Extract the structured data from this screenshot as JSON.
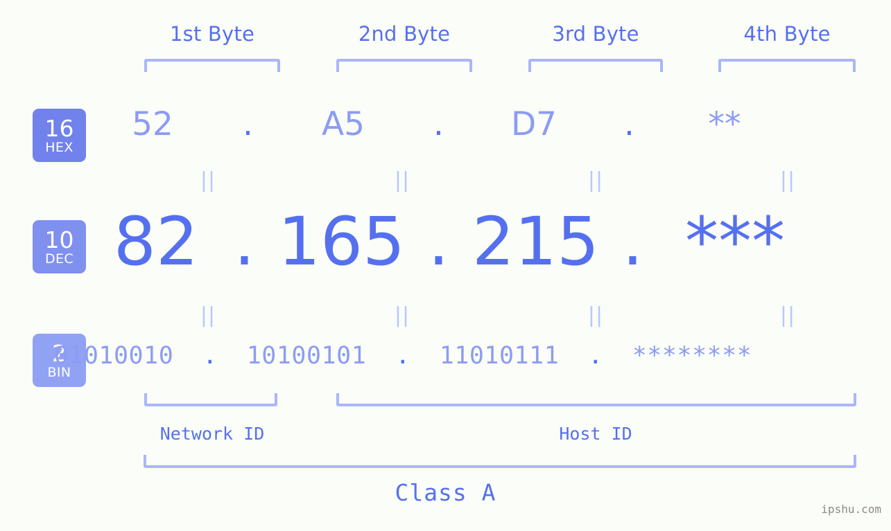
{
  "meta": {
    "watermark": "ipshu.com",
    "background_color": "#fbfdf8",
    "accent_color": "#5570ef",
    "accent_light_color": "#8c9cf2",
    "bracket_color": "#aab6fb",
    "connector_color": "#bcc6fb"
  },
  "byte_headings": [
    {
      "label": "1st Byte"
    },
    {
      "label": "2nd Byte"
    },
    {
      "label": "3rd Byte"
    },
    {
      "label": "4th Byte"
    }
  ],
  "bases": [
    {
      "number": "16",
      "name": "HEX",
      "color": "#7182ec"
    },
    {
      "number": "10",
      "name": "DEC",
      "color": "#8090ef"
    },
    {
      "number": "2",
      "name": "BIN",
      "color": "#91a2f4"
    }
  ],
  "rows": {
    "hex": {
      "bytes": [
        "52",
        "A5",
        "D7",
        "**"
      ],
      "separator": "."
    },
    "dec": {
      "bytes": [
        "82",
        "165",
        "215",
        "***"
      ],
      "separator": "."
    },
    "bin": {
      "bytes": [
        "01010010",
        "10100101",
        "11010111",
        "********"
      ],
      "separator": "."
    }
  },
  "connectors": {
    "symbol": "||",
    "count_per_row": 4
  },
  "id_labels": {
    "network": "Network ID",
    "host": "Host ID"
  },
  "class_label": "Class A"
}
